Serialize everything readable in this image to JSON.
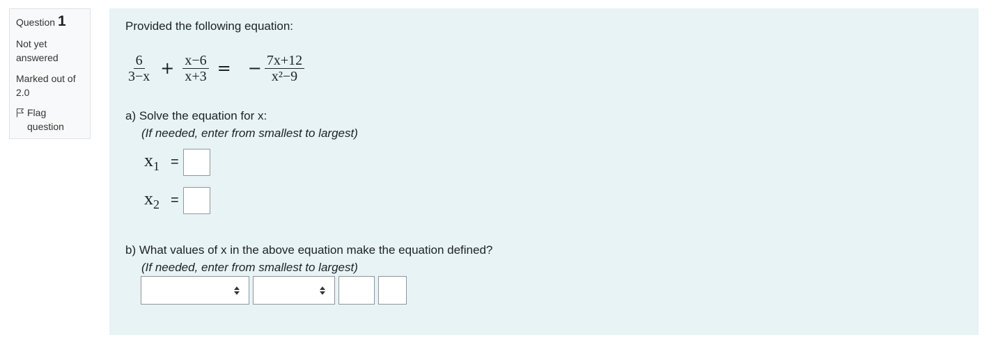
{
  "info": {
    "question_label": "Question",
    "question_number": "1",
    "state": "Not yet answered",
    "grade": "Marked out of 2.0",
    "flag_label": "Flag question",
    "flag_icon": "flag-icon"
  },
  "question": {
    "prompt": "Provided the following equation:",
    "equation": {
      "term1_num": "6",
      "term1_den": "3−x",
      "plus": "+",
      "term2_num": "x−6",
      "term2_den": "x+3",
      "equals": "=",
      "minus": "−",
      "rhs_num": "7x+12",
      "rhs_den": "x²−9"
    },
    "part_a": {
      "label": "a) Solve the equation for x:",
      "hint": "(If needed, enter from smallest to largest)",
      "answers": [
        {
          "var": "x",
          "sub": "1",
          "equals": "=",
          "value": ""
        },
        {
          "var": "x",
          "sub": "2",
          "equals": "=",
          "value": ""
        }
      ]
    },
    "part_b": {
      "label": "b) What values of x in the above equation make the equation defined?",
      "hint": "(If needed, enter from smallest to largest)",
      "select1_value": "",
      "select2_value": "",
      "input1_value": "",
      "input2_value": ""
    }
  },
  "colors": {
    "content_bg": "#e7f3f5",
    "info_bg": "#f8f9fa",
    "border": "#dee2e6"
  }
}
